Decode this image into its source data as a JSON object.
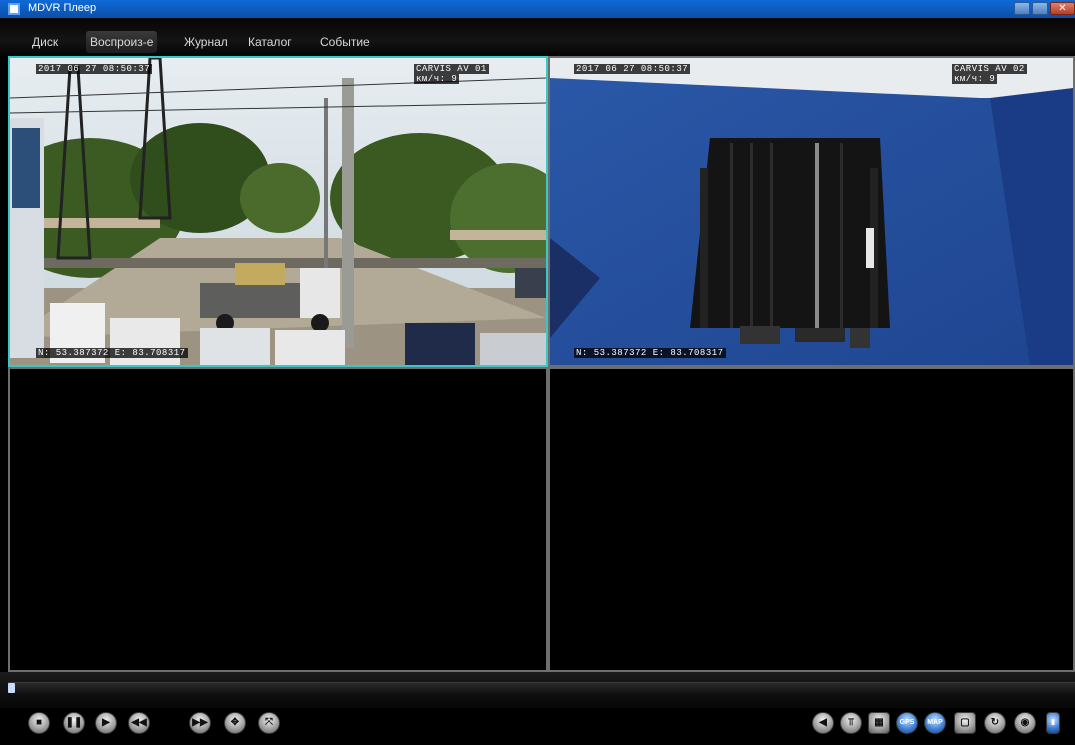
{
  "window": {
    "title": "MDVR Плеер",
    "close_glyph": "✕"
  },
  "menu": [
    {
      "label": "Диск"
    },
    {
      "label": "Воспроиз-е"
    },
    {
      "label": "Журнал"
    },
    {
      "label": "Каталог"
    },
    {
      "label": "Событие"
    }
  ],
  "active_menu": "Воспроиз-е",
  "cameras": [
    {
      "timestamp": "2017 06 27 08:50:37",
      "brand": "CARVIS AV 01",
      "speed": "км/ч:      9",
      "coords": "N: 53.387372 E: 83.708317"
    },
    {
      "timestamp": "2017 06 27 08:50:37",
      "brand": "CARVIS AV 02",
      "speed": "км/ч:      9",
      "coords": "N: 53.387372 E: 83.708317"
    }
  ],
  "timeline": {
    "progress": 0.0
  },
  "controls": {
    "left": [
      {
        "icon": "stop-icon",
        "glyph": "■"
      },
      {
        "icon": "pause-icon",
        "glyph": "❚❚"
      },
      {
        "icon": "play-icon",
        "glyph": "▶"
      },
      {
        "icon": "rewind-icon",
        "glyph": "◀◀"
      },
      {
        "icon": "fast-forward-icon",
        "glyph": "▶▶"
      },
      {
        "icon": "step-icon",
        "glyph": "✥"
      },
      {
        "icon": "fullscreen-icon",
        "glyph": "⤧"
      }
    ],
    "right": [
      {
        "icon": "volume-icon",
        "glyph": "◀"
      },
      {
        "icon": "pin-icon",
        "glyph": "⫪"
      },
      {
        "icon": "layout-icon",
        "glyph": "▦"
      },
      {
        "icon": "gps-icon",
        "glyph": "GPS"
      },
      {
        "icon": "map-icon",
        "glyph": "MAP"
      },
      {
        "icon": "window-icon",
        "glyph": "▢"
      },
      {
        "icon": "refresh-icon",
        "glyph": "↻"
      },
      {
        "icon": "snapshot-icon",
        "glyph": "◉"
      },
      {
        "icon": "clip-icon",
        "glyph": "▮"
      }
    ]
  },
  "colors": {
    "accent": "#3cc6c6",
    "titlebar": "#0f6bd6"
  }
}
